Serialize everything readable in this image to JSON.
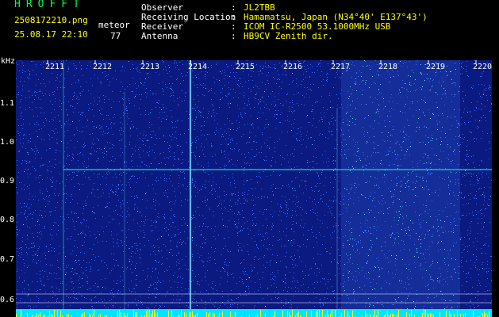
{
  "header": {
    "logo": "HROFFT",
    "filename": "2508172210.png",
    "datetime": "25.08.17 22:10",
    "meteor_label": "meteor",
    "meteor_count": "77",
    "fields": [
      {
        "label": "Observer",
        "value": "JL2TBB"
      },
      {
        "label": "Receiving Location",
        "value": "Hamamatsu, Japan (N34°40' E137°43')"
      },
      {
        "label": "Receiver",
        "value": "ICOM IC-R2500 53.1000MHz USB"
      },
      {
        "label": "Antenna",
        "value": "HB9CV Zenith dir."
      }
    ],
    "separator": ":"
  },
  "axes": {
    "y_unit": "kHz",
    "y_ticks": [
      "1.1",
      "1.0",
      "0.9",
      "0.8",
      "0.7",
      "0.6"
    ],
    "x_ticks": [
      "2211",
      "2212",
      "2213",
      "2214",
      "2215",
      "2216",
      "2217",
      "2218",
      "2219",
      "2220"
    ]
  },
  "colors": {
    "background": "#000000",
    "spectrum_base": "#0a1a80",
    "spectrum_dot": "#3a6bff",
    "bright_dot": "#6fd3ff",
    "marker_line": "#00ffcc",
    "baseline_bar": "#00e5ff",
    "baseline_peaks": "#ffff00",
    "header_text": "#ffffff",
    "header_yellow": "#ffff00",
    "logo": "#00ff44"
  }
}
